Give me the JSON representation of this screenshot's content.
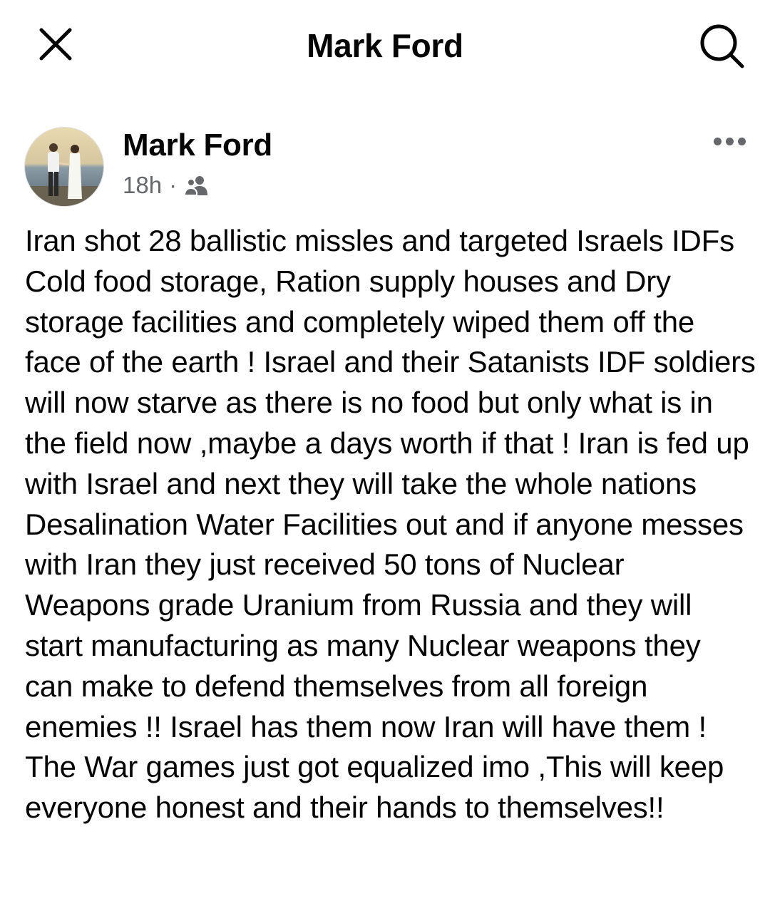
{
  "header": {
    "title": "Mark Ford",
    "close_icon": "close-icon",
    "search_icon": "search-icon"
  },
  "post": {
    "author": "Mark Ford",
    "time": "18h",
    "separator": "·",
    "audience_icon": "friends-icon",
    "more_icon": "more-horizontal-icon",
    "text": "Iran shot 28 ballistic missles and targeted Israels IDFs Cold food storage, Ration supply houses and Dry storage facilities and completely wiped them off the face of the earth ! Israel and their Satanists IDF soldiers will now starve as there is no food but only what is in the field now ,maybe a days worth if that ! Iran is fed up with Israel and next they will take the whole nations Desalination Water Facilities out and if anyone messes with Iran they just received 50 tons of Nuclear Weapons grade Uranium from Russia and they will start manufacturing as many Nuclear weapons they can make to defend themselves from all foreign enemies !! Israel has them now Iran will have them ! The War games just got equalized imo ,This will keep everyone honest and their hands to themselves!!"
  },
  "colors": {
    "text_primary": "#050505",
    "text_secondary": "#65676b",
    "background": "#ffffff"
  }
}
